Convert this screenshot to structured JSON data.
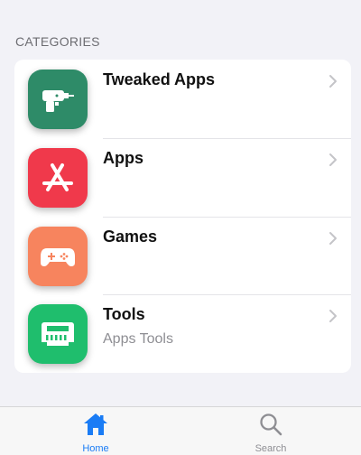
{
  "section": {
    "title": "CATEGORIES"
  },
  "categories": [
    {
      "title": "Tweaked Apps",
      "subtitle": "",
      "icon": "drill-icon",
      "color": "#2e8b68"
    },
    {
      "title": "Apps",
      "subtitle": "",
      "icon": "app-store-icon",
      "color": "#f0394b"
    },
    {
      "title": "Games",
      "subtitle": "",
      "icon": "gamepad-icon",
      "color": "#f7845e"
    },
    {
      "title": "Tools",
      "subtitle": "Apps Tools",
      "icon": "toolbox-icon",
      "color": "#1fbe6d"
    }
  ],
  "tabbar": {
    "home": {
      "label": "Home",
      "icon": "house-icon",
      "active": true,
      "color": "#1a7cf5"
    },
    "search": {
      "label": "Search",
      "icon": "magnifier-icon",
      "active": false,
      "color": "#8e8e93"
    }
  }
}
